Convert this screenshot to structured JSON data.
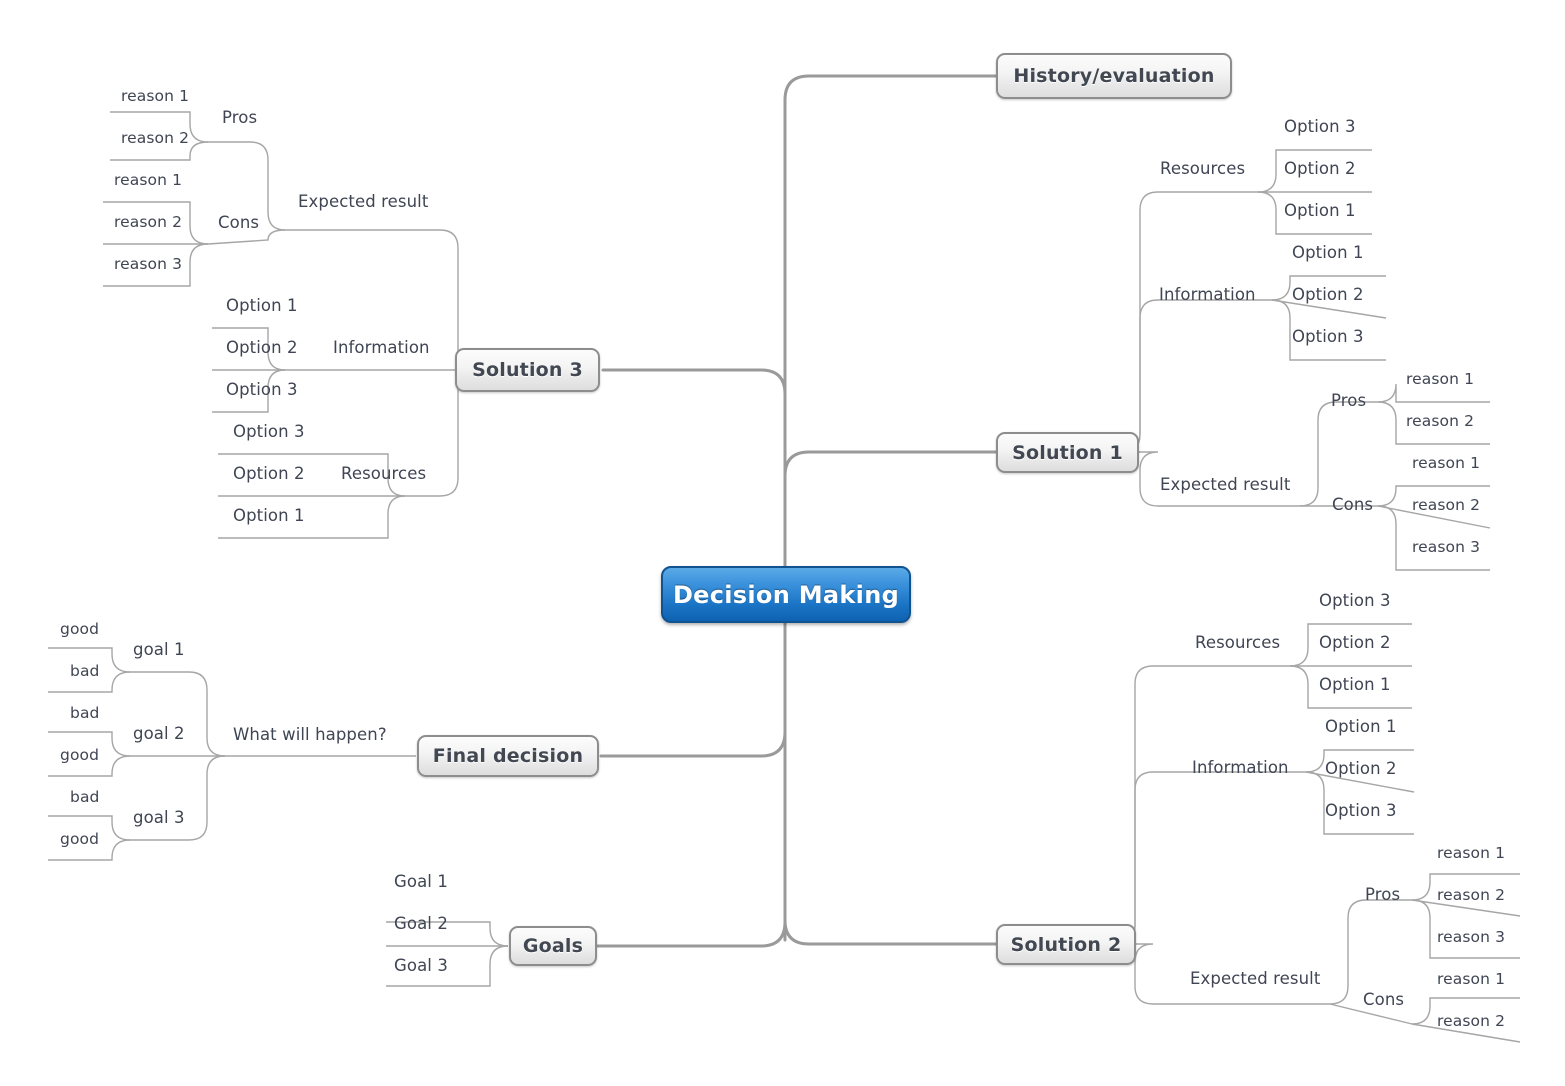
{
  "diagram": {
    "title": "Decision Making",
    "type": "mind-map",
    "central": {
      "label": "Decision Making",
      "color": "#1a73c4"
    },
    "topic_color": "#e8e8e8",
    "line_color": "#9a9a9a",
    "leaf_line_color": "#b0b0b0",
    "text_color": "#3f4553"
  },
  "topics": {
    "history": "History/evaluation",
    "solution1": "Solution 1",
    "solution2": "Solution 2",
    "solution3": "Solution 3",
    "final_decision": "Final decision",
    "goals": "Goals"
  },
  "labels": {
    "pros": "Pros",
    "cons": "Cons",
    "expected_result": "Expected result",
    "information": "Information",
    "resources": "Resources",
    "what_will_happen": "What will happen?",
    "reason1": "reason 1",
    "reason2": "reason 2",
    "reason3": "reason 3",
    "option1": "Option 1",
    "option2": "Option 2",
    "option3": "Option 3",
    "goal1_cap": "Goal 1",
    "goal2_cap": "Goal 2",
    "goal3_cap": "Goal 3",
    "goal1": "goal 1",
    "goal2": "goal 2",
    "goal3": "goal 3",
    "good": "good",
    "bad": "bad"
  },
  "nodes": {
    "s3_pros_r1": "reason 1",
    "s3_pros_r2": "reason 2",
    "s3_pros": "Pros",
    "s3_cons_r1": "reason 1",
    "s3_cons_r2": "reason 2",
    "s3_cons_r3": "reason 3",
    "s3_cons": "Cons",
    "s3_expected": "Expected result",
    "s3_info_o1": "Option 1",
    "s3_info_o2": "Option 2",
    "s3_info_o3": "Option 3",
    "s3_info": "Information",
    "s3_res_o3": "Option 3",
    "s3_res_o2": "Option 2",
    "s3_res_o1": "Option 1",
    "s3_res": "Resources",
    "s1_res_o3": "Option 3",
    "s1_res_o2": "Option 2",
    "s1_res_o1": "Option 1",
    "s1_res": "Resources",
    "s1_info_o1": "Option 1",
    "s1_info_o2": "Option 2",
    "s1_info_o3": "Option 3",
    "s1_info": "Information",
    "s1_pros_r1": "reason 1",
    "s1_pros_r2": "reason 2",
    "s1_pros": "Pros",
    "s1_cons_r1": "reason 1",
    "s1_cons_r2": "reason 2",
    "s1_cons_r3": "reason 3",
    "s1_cons": "Cons",
    "s1_expected": "Expected result",
    "s2_res_o3": "Option 3",
    "s2_res_o2": "Option 2",
    "s2_res_o1": "Option 1",
    "s2_res": "Resources",
    "s2_info_o1": "Option 1",
    "s2_info_o2": "Option 2",
    "s2_info_o3": "Option 3",
    "s2_info": "Information",
    "s2_pros_r1": "reason 1",
    "s2_pros_r2": "reason 2",
    "s2_pros_r3": "reason 3",
    "s2_pros": "Pros",
    "s2_cons_r1": "reason 1",
    "s2_cons_r2": "reason 2",
    "s2_cons": "Cons",
    "s2_expected": "Expected result",
    "fd_g1_good": "good",
    "fd_g1_bad": "bad",
    "fd_goal1": "goal 1",
    "fd_g2_bad": "bad",
    "fd_g2_good": "good",
    "fd_goal2": "goal 2",
    "fd_g3_bad": "bad",
    "fd_g3_good": "good",
    "fd_goal3": "goal 3",
    "fd_what": "What will happen?",
    "goals_g1": "Goal 1",
    "goals_g2": "Goal 2",
    "goals_g3": "Goal 3"
  }
}
